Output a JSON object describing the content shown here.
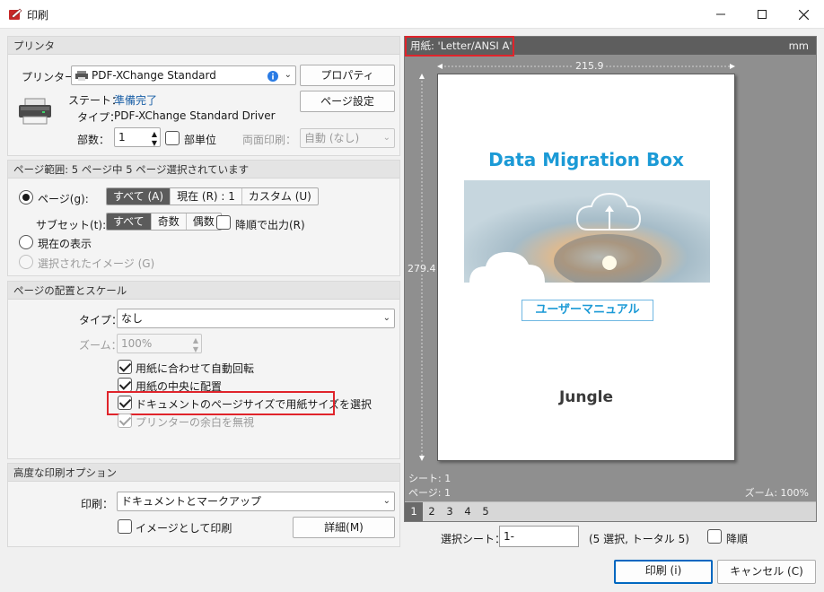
{
  "window": {
    "title": "印刷"
  },
  "printer_group": {
    "header": "プリンタ",
    "printer_label": "プリンター...",
    "printer_name": "PDF-XChange Standard",
    "properties_button": "プロパティ",
    "page_setup_button": "ページ設定",
    "status_label": "ステート：",
    "status_value": "準備完了",
    "type_label": "タイプ：",
    "type_value": "PDF-XChange Standard Driver",
    "copies_label": "部数：",
    "copies_value": "1",
    "collate_label": "部単位",
    "duplex_label": "両面印刷：",
    "duplex_value": "自動 (なし)"
  },
  "range_group": {
    "header": "ページ範囲: 5 ページ中 5 ページ選択されています",
    "pages_label": "ページ(g):",
    "range_options": [
      "すべて (A)",
      "現在 (R) : 1",
      "カスタム (U)"
    ],
    "subset_label": "サブセット(t):",
    "subset_options": [
      "すべて",
      "奇数",
      "偶数"
    ],
    "reverse_label": "降順で出力(R)",
    "current_view_label": "現在の表示",
    "selected_image_label": "選択されたイメージ (G)"
  },
  "layout_group": {
    "header": "ページの配置とスケール",
    "type_label": "タイプ：",
    "type_value": "なし",
    "zoom_label": "ズーム：",
    "zoom_value": "100%",
    "auto_rotate": "用紙に合わせて自動回転",
    "center": "用紙の中央に配置",
    "choose_paper": "ドキュメントのページサイズで用紙サイズを選択",
    "ignore_margins": "プリンターの余白を無視"
  },
  "advanced_group": {
    "header": "高度な印刷オプション",
    "print_label": "印刷：",
    "print_value": "ドキュメントとマークアップ",
    "as_image_label": "イメージとして印刷",
    "details_button": "詳細(M)"
  },
  "preview": {
    "paper_label": "用紙: 'Letter/ANSI A'",
    "unit": "mm",
    "width": "215.9",
    "height": "279.4",
    "sheet": "シート: 1",
    "page": "ページ: 1",
    "zoom": "ズーム: 100%",
    "pages": [
      "1",
      "2",
      "3",
      "4",
      "5"
    ],
    "doc_title": "Data Migration Box",
    "doc_subtitle": "ユーザーマニュアル",
    "doc_brand": "Jungle"
  },
  "bottom": {
    "select_sheets_label": "選択シート：",
    "select_sheets_value": "1-",
    "selection_info": "(5 選択, トータル 5)",
    "reverse_label": "降順",
    "print_button": "印刷 (i)",
    "cancel_button": "キャンセル (C)"
  },
  "colors": {
    "accent": "#0067c0",
    "highlight_red": "#e0242b",
    "doc_title_blue": "#1b9ad6"
  }
}
